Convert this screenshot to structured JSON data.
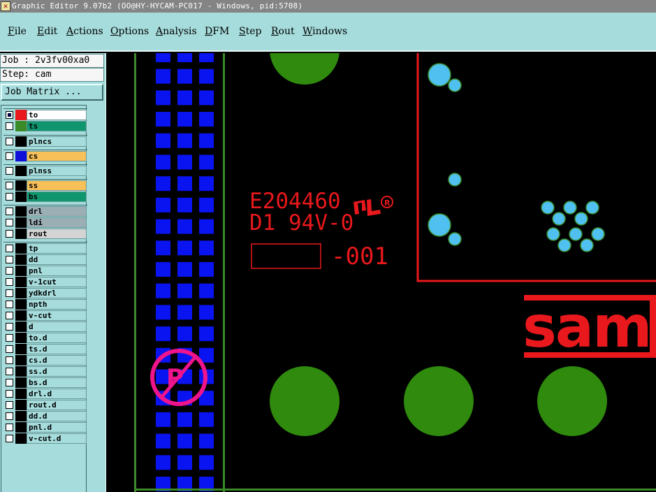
{
  "window": {
    "title": "Graphic Editor 9.07b2 (OO@HY-HYCAM-PC017 - Windows, pid:5708)",
    "icon": "x-app-icon"
  },
  "menu": [
    "File",
    "Edit",
    "Actions",
    "Options",
    "Analysis",
    "DFM",
    "Step",
    "Rout",
    "Windows"
  ],
  "left_panel": {
    "job_label": "Job : 2v3fv00xa0",
    "step_label": "Step: cam",
    "job_matrix_label": "Job Matrix ...",
    "layers": [
      {
        "name": "to",
        "color": "#e8181c",
        "name_bg": "#ffffff",
        "checked": true
      },
      {
        "name": "ts",
        "color": "#3a8a28",
        "name_bg": "#10966e",
        "checked": false
      },
      {
        "name": "plncs",
        "color": "#000000",
        "name_bg": "#a6dcdc",
        "checked": false
      },
      {
        "name": "cs",
        "color": "#1010d8",
        "name_bg": "#f8c058",
        "checked": false
      },
      {
        "name": "plnss",
        "color": "#000000",
        "name_bg": "#a6dcdc",
        "checked": false
      },
      {
        "name": "ss",
        "color": "#000000",
        "name_bg": "#f8c058",
        "checked": false
      },
      {
        "name": "bs",
        "color": "#000000",
        "name_bg": "#10966e",
        "checked": false
      },
      {
        "name": "drl",
        "color": "#000000",
        "name_bg": "#9aaeb4",
        "checked": false
      },
      {
        "name": "ldi",
        "color": "#000000",
        "name_bg": "#9aaeb4",
        "checked": false
      },
      {
        "name": "rout",
        "color": "#000000",
        "name_bg": "#d4d4d4",
        "checked": false
      },
      {
        "name": "tp",
        "color": "#000000",
        "name_bg": "#a6dcdc",
        "checked": false
      },
      {
        "name": "dd",
        "color": "#000000",
        "name_bg": "#a6dcdc",
        "checked": false
      },
      {
        "name": "pnl",
        "color": "#000000",
        "name_bg": "#a6dcdc",
        "checked": false
      },
      {
        "name": "v-1cut",
        "color": "#000000",
        "name_bg": "#a6dcdc",
        "checked": false
      },
      {
        "name": "ydkdrl",
        "color": "#000000",
        "name_bg": "#a6dcdc",
        "checked": false
      },
      {
        "name": "npth",
        "color": "#000000",
        "name_bg": "#a6dcdc",
        "checked": false
      },
      {
        "name": "v-cut",
        "color": "#000000",
        "name_bg": "#a6dcdc",
        "checked": false
      },
      {
        "name": "d",
        "color": "#000000",
        "name_bg": "#a6dcdc",
        "checked": false
      },
      {
        "name": "to.d",
        "color": "#000000",
        "name_bg": "#a6dcdc",
        "checked": false
      },
      {
        "name": "ts.d",
        "color": "#000000",
        "name_bg": "#a6dcdc",
        "checked": false
      },
      {
        "name": "cs.d",
        "color": "#000000",
        "name_bg": "#a6dcdc",
        "checked": false
      },
      {
        "name": "ss.d",
        "color": "#000000",
        "name_bg": "#a6dcdc",
        "checked": false
      },
      {
        "name": "bs.d",
        "color": "#000000",
        "name_bg": "#a6dcdc",
        "checked": false
      },
      {
        "name": "drl.d",
        "color": "#000000",
        "name_bg": "#a6dcdc",
        "checked": false
      },
      {
        "name": "rout.d",
        "color": "#000000",
        "name_bg": "#a6dcdc",
        "checked": false
      },
      {
        "name": "dd.d",
        "color": "#000000",
        "name_bg": "#a6dcdc",
        "checked": false
      },
      {
        "name": "pnl.d",
        "color": "#000000",
        "name_bg": "#a6dcdc",
        "checked": false
      },
      {
        "name": "v-cut.d",
        "color": "#000000",
        "name_bg": "#a6dcdc",
        "checked": false
      }
    ]
  },
  "canvas": {
    "silkscreen_line1": "E204460",
    "silkscreen_line2": "D1 94V-0",
    "part_suffix": "-001",
    "logo_text": "sam",
    "colors": {
      "background": "#000000",
      "copper_pad": "#2f8a0e",
      "board_outline": "#3a8a28",
      "silkscreen": "#e8181c",
      "cs_pad": "#0a14f0",
      "drill": "#50c0f0",
      "fiducial": "#f0148c"
    }
  }
}
